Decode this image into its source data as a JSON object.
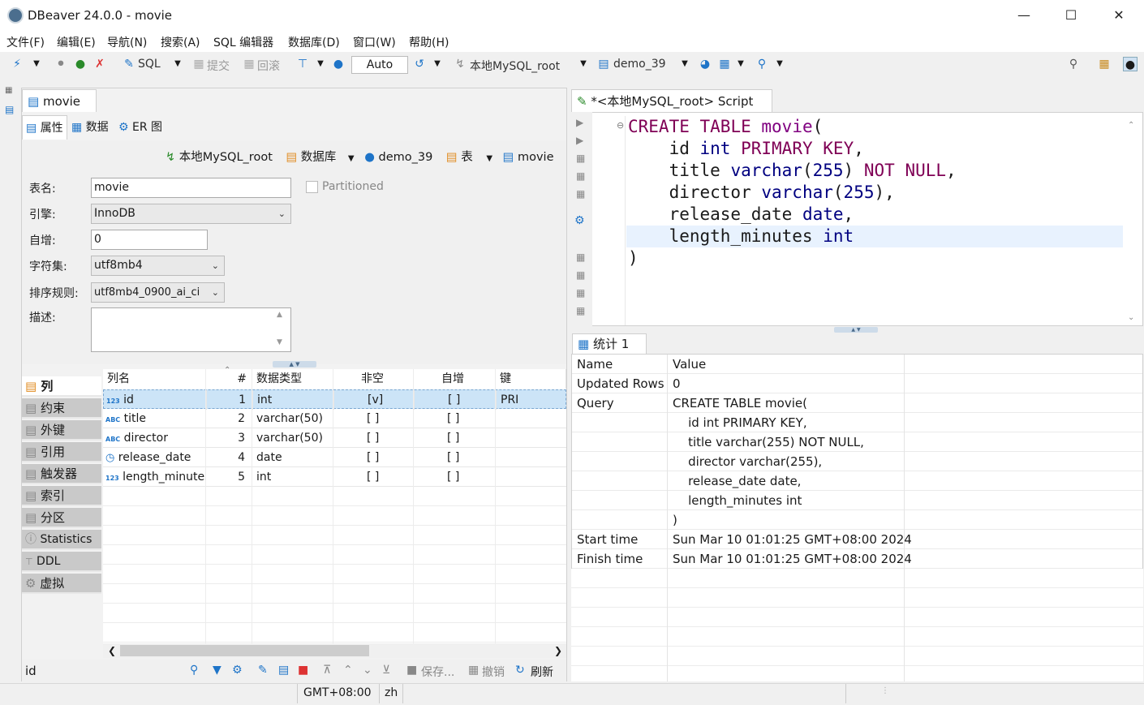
{
  "window": {
    "title": "DBeaver 24.0.0 - movie"
  },
  "menu": [
    "文件(F)",
    "编辑(E)",
    "导航(N)",
    "搜索(A)",
    "SQL 编辑器",
    "数据库(D)",
    "窗口(W)",
    "帮助(H)"
  ],
  "toolbar": {
    "sql": "SQL",
    "commit": "提交",
    "rollback": "回滚",
    "tx_mode": "Auto",
    "connection": "本地MySQL_root",
    "database": "demo_39"
  },
  "left_editor": {
    "tab_title": "movie",
    "subtabs": [
      "属性",
      "数据",
      "ER 图"
    ],
    "breadcrumb": [
      "本地MySQL_root",
      "数据库",
      "demo_39",
      "表",
      "movie"
    ],
    "props": {
      "table_name_label": "表名:",
      "table_name": "movie",
      "partitioned": "Partitioned",
      "engine_label": "引擎:",
      "engine": "InnoDB",
      "autoinc_label": "自增:",
      "autoinc": "0",
      "charset_label": "字符集:",
      "charset": "utf8mb4",
      "collation_label": "排序规则:",
      "collation": "utf8mb4_0900_ai_ci",
      "desc_label": "描述:"
    },
    "nav": [
      "列",
      "约束",
      "外键",
      "引用",
      "触发器",
      "索引",
      "分区",
      "Statistics",
      "DDL",
      "虚拟"
    ],
    "columns_header": [
      "列名",
      "#",
      "数据类型",
      "非空",
      "自增",
      "键"
    ],
    "columns": [
      {
        "icon": "123",
        "name": "id",
        "num": "1",
        "type": "int",
        "notnull": "[v]",
        "autoinc": "[ ]",
        "key": "PRI"
      },
      {
        "icon": "ABC",
        "name": "title",
        "num": "2",
        "type": "varchar(50)",
        "notnull": "[ ]",
        "autoinc": "[ ]",
        "key": ""
      },
      {
        "icon": "ABC",
        "name": "director",
        "num": "3",
        "type": "varchar(50)",
        "notnull": "[ ]",
        "autoinc": "[ ]",
        "key": ""
      },
      {
        "icon": "clock",
        "name": "release_date",
        "num": "4",
        "type": "date",
        "notnull": "[ ]",
        "autoinc": "[ ]",
        "key": ""
      },
      {
        "icon": "123",
        "name": "length_minutes",
        "num": "5",
        "type": "int",
        "notnull": "[ ]",
        "autoinc": "[ ]",
        "key": ""
      }
    ],
    "bottom": {
      "selected": "id",
      "save": "保存...",
      "undo": "撤销",
      "refresh": "刷新"
    }
  },
  "script": {
    "tab_title": "*<本地MySQL_root> Script",
    "lines": [
      "CREATE TABLE movie(",
      "    id int PRIMARY KEY,",
      "    title varchar(255) NOT NULL,",
      "    director varchar(255),",
      "    release_date date,",
      "    length_minutes int",
      ")"
    ]
  },
  "stats": {
    "tab_title": "统计 1",
    "header": [
      "Name",
      "Value"
    ],
    "rows": [
      {
        "name": "Updated Rows",
        "value": "0"
      },
      {
        "name": "Query",
        "value": "CREATE TABLE movie("
      },
      {
        "name": "",
        "value": "    id int PRIMARY KEY,"
      },
      {
        "name": "",
        "value": "    title varchar(255) NOT NULL,"
      },
      {
        "name": "",
        "value": "    director varchar(255),"
      },
      {
        "name": "",
        "value": "    release_date date,"
      },
      {
        "name": "",
        "value": "    length_minutes int"
      },
      {
        "name": "",
        "value": ")"
      },
      {
        "name": "Start time",
        "value": "Sun Mar 10 01:01:25 GMT+08:00 2024"
      },
      {
        "name": "Finish time",
        "value": "Sun Mar 10 01:01:25 GMT+08:00 2024"
      }
    ]
  },
  "status": {
    "timezone": "GMT+08:00",
    "locale": "zh"
  },
  "colors": {
    "accent": "#1e74c8",
    "selection": "#cce4f7",
    "keyword": "#7f0055"
  }
}
